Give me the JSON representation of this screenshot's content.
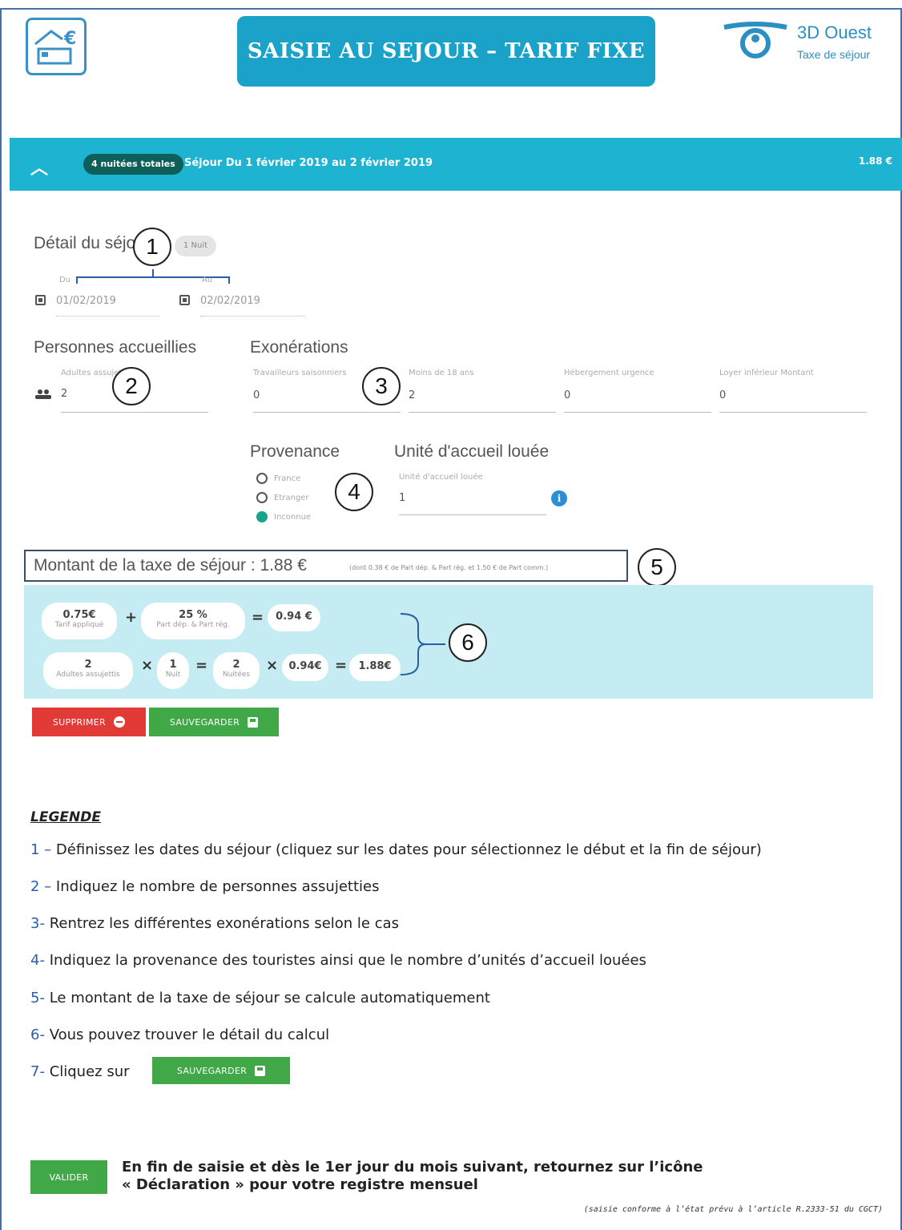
{
  "header": {
    "title": "SAISIE AU SEJOUR – TARIF FIXE",
    "brand_name": "3D Ouest",
    "brand_sub": "Taxe de séjour"
  },
  "bar": {
    "pill": "4 nuitées totales",
    "sejour": "Séjour Du 1 février 2019 au 2 février 2019",
    "amount": "1.88 €"
  },
  "detail": {
    "title": "Détail du séjour",
    "nuit_pill": "1 Nuit",
    "du_label": "Du",
    "au_label": "Au",
    "date_from": "01/02/2019",
    "date_to": "02/02/2019"
  },
  "personnes": {
    "title": "Personnes accueillies",
    "label": "Adultes assujettis",
    "value": "2"
  },
  "exonerations": {
    "title": "Exonérations",
    "fields": [
      {
        "label": "Travailleurs saisonniers",
        "value": "0"
      },
      {
        "label": "Moins de 18 ans",
        "value": "2"
      },
      {
        "label": "Hébergement urgence",
        "value": "0"
      },
      {
        "label": "Loyer inférieur Montant",
        "value": "0"
      }
    ]
  },
  "provenance": {
    "title": "Provenance",
    "options": [
      "France",
      "Etranger",
      "Inconnue"
    ],
    "selected": "Inconnue"
  },
  "unite": {
    "title": "Unité d'accueil louée",
    "label": "Unité d'accueil louée",
    "value": "1"
  },
  "montant": {
    "main": "Montant de la taxe de séjour : 1.88 €",
    "detail": "(dont 0.38 € de Part dép. & Part rég. et 1.50 € de Part comm.)"
  },
  "calc": {
    "tarif_value": "0.75€",
    "tarif_label": "Tarif appliqué",
    "part_value": "25 %",
    "part_label": "Part dép. & Part rég.",
    "result1": "0.94 €",
    "adultes_value": "2",
    "adultes_label": "Adultes assujettis",
    "nuit_value": "1",
    "nuit_label": "Nuit",
    "nuitees_value": "2",
    "nuitees_label": "Nuitées",
    "unit_value": "0.94€",
    "total_value": "1.88€",
    "op_plus": "+",
    "op_eq": "=",
    "op_times": "×"
  },
  "buttons": {
    "supprimer": "SUPPRIMER",
    "sauvegarder": "SAUVEGARDER",
    "valider": "VALIDER"
  },
  "annotations": [
    "1",
    "2",
    "3",
    "4",
    "5",
    "6"
  ],
  "legend": {
    "title": "LEGENDE",
    "items": [
      {
        "n": "1 –",
        "text": "Définissez les dates du séjour (cliquez sur les dates pour sélectionnez le début et la fin de séjour)"
      },
      {
        "n": "2 –",
        "text": "Indiquez le nombre de personnes assujetties"
      },
      {
        "n": "3-",
        "text": "Rentrez les différentes exonérations selon le cas"
      },
      {
        "n": "4-",
        "text": "Indiquez la provenance des touristes ainsi que le nombre d’unités d’accueil louées"
      },
      {
        "n": "5-",
        "text": "Le montant de la taxe de séjour se calcule automatiquement"
      },
      {
        "n": "6-",
        "text": "Vous pouvez trouver le détail du calcul"
      },
      {
        "n": "7-",
        "text": "Cliquez sur"
      }
    ]
  },
  "final": {
    "line1": "En fin de saisie et dès le 1er jour du mois suivant, retournez sur l’icône",
    "line2": "« Déclaration » pour votre registre mensuel"
  },
  "footnote": "(saisie conforme à l’état prévu à l’article R.2333-51 du CGCT)",
  "colors": {
    "title_bg": "#1aa2c9",
    "bar_bg": "#1fb3d2",
    "calc_bg": "#c6ecf3",
    "danger": "#e23a36",
    "success": "#41a847"
  }
}
